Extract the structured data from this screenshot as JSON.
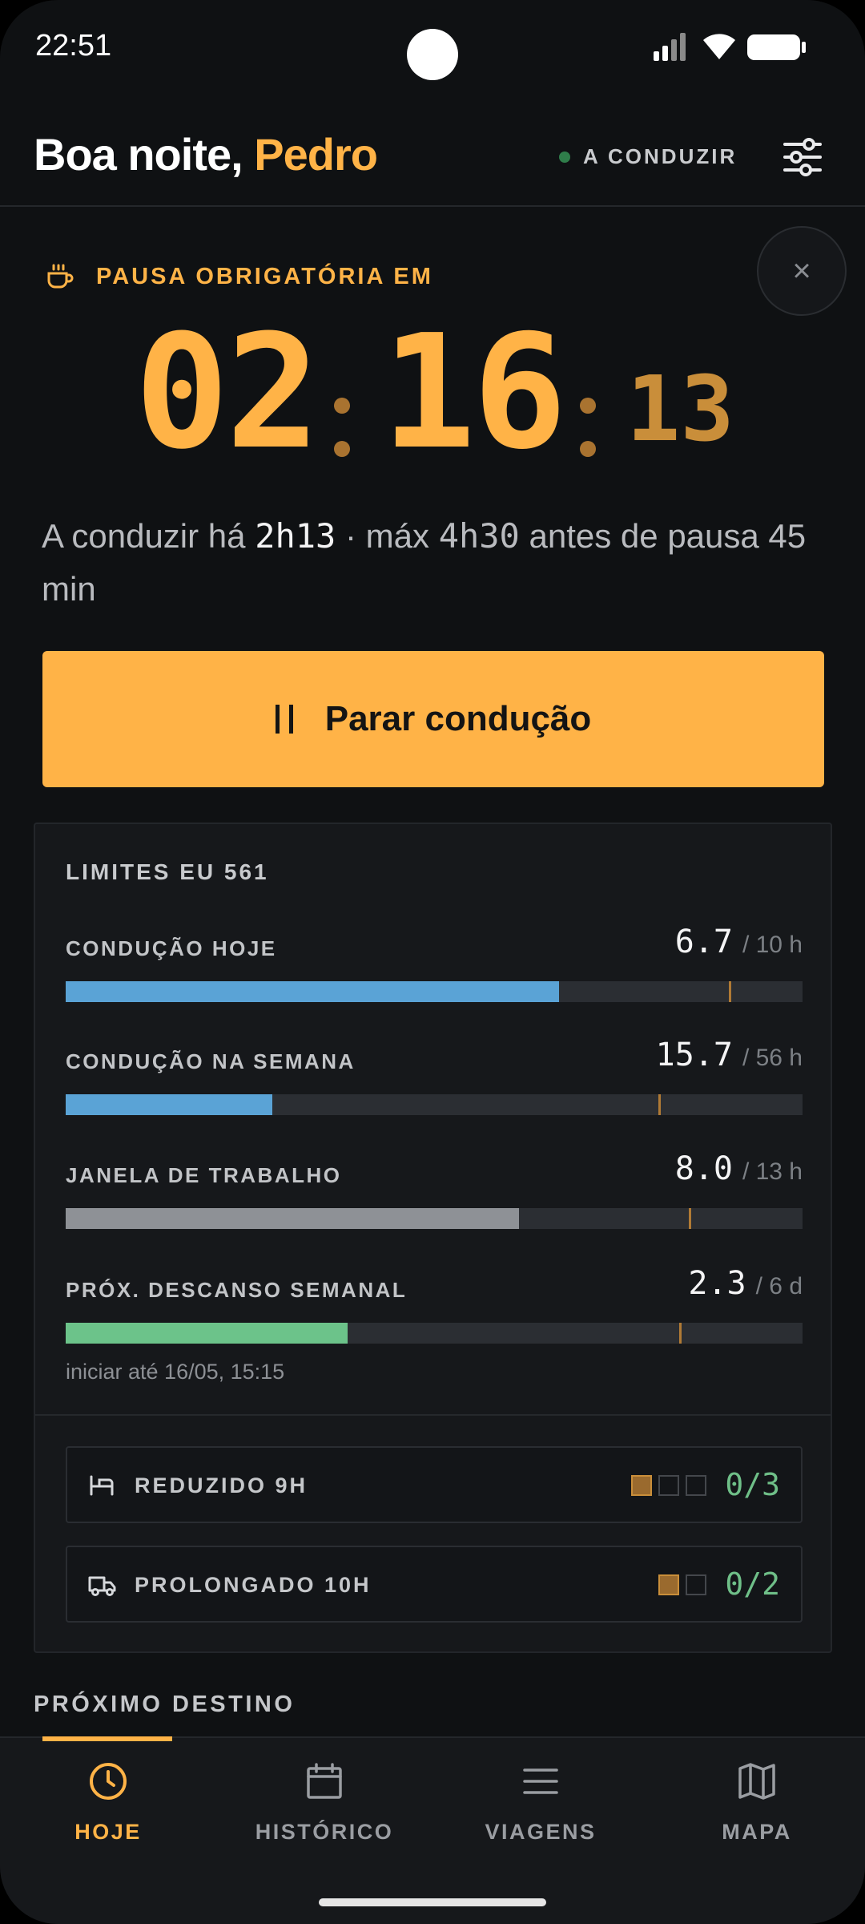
{
  "status_bar": {
    "time": "22:51"
  },
  "header": {
    "greeting": "Boa noite,",
    "user_name": "Pedro",
    "driving_status": "A CONDUZIR"
  },
  "break_card": {
    "label": "PAUSA OBRIGATÓRIA EM",
    "timer": {
      "hours": "02",
      "minutes": "16",
      "seconds": "13"
    },
    "info_prefix": "A conduzir há",
    "info_driven": "2h13",
    "info_middle": "· máx",
    "info_max": "4h30",
    "info_suffix": "antes de pausa 45 min",
    "stop_label": "Parar condução"
  },
  "limits": {
    "title": "LIMITES EU 561",
    "rows": [
      {
        "label": "CONDUÇÃO HOJE",
        "value": "6.7",
        "max": "/ 10 h",
        "fraction": 0.67,
        "marker": 0.9,
        "color": "#5aa3d6",
        "sub": ""
      },
      {
        "label": "CONDUÇÃO NA SEMANA",
        "value": "15.7",
        "max": "/ 56 h",
        "fraction": 0.28,
        "marker": 0.804,
        "color": "#5aa3d6",
        "sub": ""
      },
      {
        "label": "JANELA DE TRABALHO",
        "value": "8.0",
        "max": "/ 13 h",
        "fraction": 0.615,
        "marker": 0.846,
        "color": "#8e9196",
        "sub": ""
      },
      {
        "label": "PRÓX. DESCANSO SEMANAL",
        "value": "2.3",
        "max": "/ 6 d",
        "fraction": 0.383,
        "marker": 0.833,
        "color": "#6cc38a",
        "sub": "iniciar até 16/05, 15:15"
      }
    ],
    "quotas": [
      {
        "label": "REDUZIDO 9H",
        "icon": "bed-icon",
        "used": 1,
        "total": 3,
        "count": "0/3"
      },
      {
        "label": "PROLONGADO 10H",
        "icon": "truck-icon",
        "used": 1,
        "total": 2,
        "count": "0/2"
      }
    ]
  },
  "next_destination": {
    "title": "PRÓXIMO DESTINO"
  },
  "nav": {
    "items": [
      {
        "label": "HOJE",
        "icon": "clock-icon",
        "active": true
      },
      {
        "label": "HISTÓRICO",
        "icon": "calendar-icon",
        "active": false
      },
      {
        "label": "VIAGENS",
        "icon": "list-icon",
        "active": false
      },
      {
        "label": "MAPA",
        "icon": "map-icon",
        "active": false
      }
    ]
  },
  "colors": {
    "accent": "#ffb347",
    "background": "#0f1113",
    "card": "#16181b",
    "success": "#6fbf88"
  }
}
